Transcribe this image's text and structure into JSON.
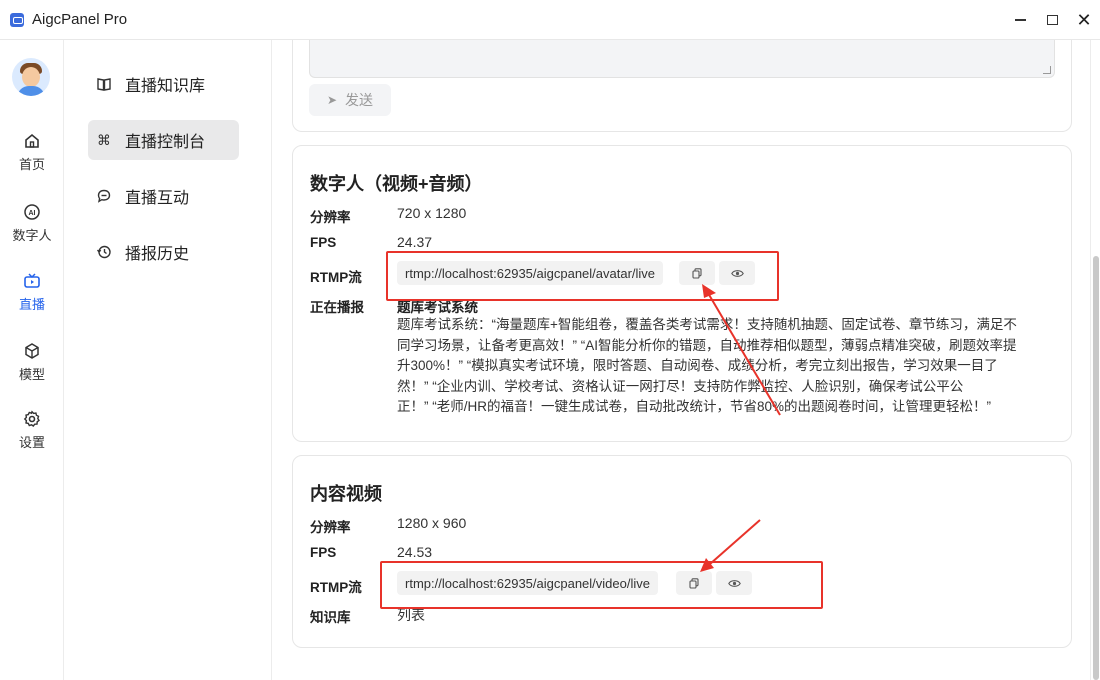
{
  "window": {
    "title": "AigcPanel Pro",
    "minimize": "—",
    "maximize": "☐",
    "close": "✕"
  },
  "nav": {
    "items": [
      {
        "label": "首页",
        "icon": "home-icon"
      },
      {
        "label": "数字人",
        "icon": "ai-icon"
      },
      {
        "label": "直播",
        "icon": "tv-icon",
        "active": true
      },
      {
        "label": "模型",
        "icon": "cube-icon"
      },
      {
        "label": "设置",
        "icon": "gear-icon"
      }
    ]
  },
  "menu": {
    "items": [
      {
        "label": "直播知识库",
        "icon": "book-icon",
        "glyph": "📖"
      },
      {
        "label": "直播控制台",
        "icon": "command-icon",
        "glyph": "⌘",
        "active": true
      },
      {
        "label": "直播互动",
        "icon": "chat-icon",
        "glyph": "💬"
      },
      {
        "label": "播报历史",
        "icon": "history-icon",
        "glyph": "⟲"
      }
    ]
  },
  "send": {
    "label": "发送"
  },
  "avatar_card": {
    "title": "数字人（视频+音频）",
    "resolution_label": "分辨率",
    "resolution": "720 x 1280",
    "fps_label": "FPS",
    "fps": "24.37",
    "rtmp_label": "RTMP流",
    "rtmp": "rtmp://localhost:62935/aigcpanel/avatar/live",
    "playing_label": "正在播报",
    "playing_title": "题库考试系统",
    "playing_lines": [
      "题库考试系统：“海量题库+智能组卷，覆盖各类考试需求！支持随机抽题、固定试卷、章节练习，满足不",
      "同学习场景，让备考更高效！” “AI智能分析你的错题，自动推荐相似题型，薄弱点精准突破，刷题效率提",
      "升300%！” “模拟真实考试环境，限时答题、自动阅卷、成绩分析，考完立刻出报告，学习效果一目了",
      "然！” “企业内训、学校考试、资格认证一网打尽！支持防作弊监控、人脸识别，确保考试公平公",
      "正！” “老师/HR的福音！一键生成试卷，自动批改统计，节省80%的出题阅卷时间，让管理更轻松！”"
    ]
  },
  "video_card": {
    "title": "内容视频",
    "resolution_label": "分辨率",
    "resolution": "1280 x 960",
    "fps_label": "FPS",
    "fps": "24.53",
    "rtmp_label": "RTMP流",
    "rtmp": "rtmp://localhost:62935/aigcpanel/video/live",
    "kb_label": "知识库",
    "kb_value": "列表"
  },
  "colors": {
    "accent": "#2563eb",
    "highlight": "#e8332a"
  }
}
